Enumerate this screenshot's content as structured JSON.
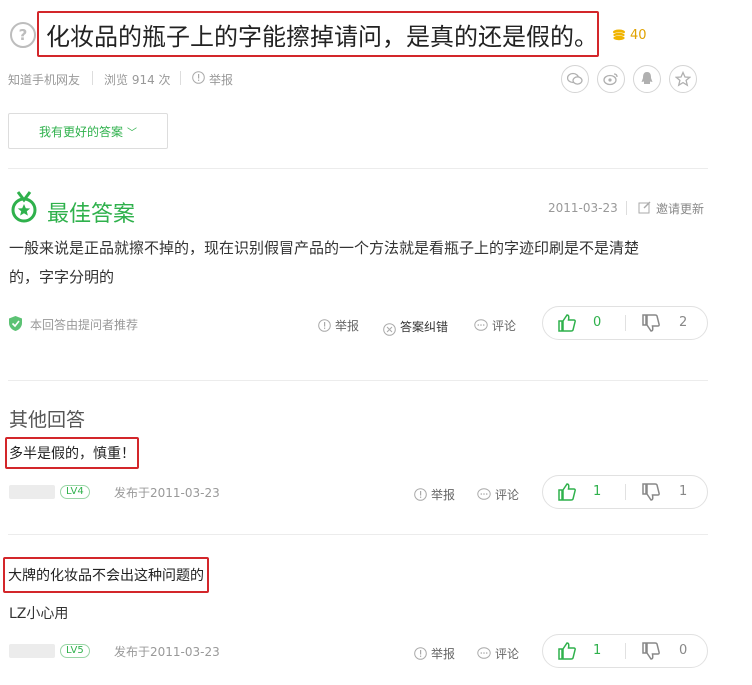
{
  "question": {
    "title": "化妆品的瓶子上的字能擦掉请问，是真的还是假的。",
    "reward": "40",
    "source": "知道手机网友",
    "views": "浏览 914 次",
    "report": "举报"
  },
  "better_answer_button": "我有更好的答案",
  "best_answer": {
    "heading": "最佳答案",
    "date": "2011-03-23",
    "invite": "邀请更新",
    "text_line1": "一般来说是正品就擦不掉的，现在识别假冒产品的一个方法就是看瓶子上的字迹印刷是不是清楚",
    "text_line2": "的，字字分明的",
    "recommended": "本回答由提问者推荐",
    "report": "举报",
    "correct": "答案纠错",
    "comment": "评论",
    "up": "0",
    "down": "2"
  },
  "other_answers": {
    "heading": "其他回答",
    "items": [
      {
        "text": "多半是假的，慎重！",
        "level": "LV4",
        "posted": "发布于2011-03-23",
        "report": "举报",
        "comment": "评论",
        "up": "1",
        "down": "1"
      },
      {
        "text": "大牌的化妆品不会出这种问题的",
        "text2": "LZ小心用",
        "level": "LV5",
        "posted": "发布于2011-03-23",
        "report": "举报",
        "comment": "评论",
        "up": "1",
        "down": "0"
      }
    ]
  },
  "colors": {
    "accent": "#2fb14c",
    "highlight": "#d3262a",
    "coin": "#e0a200"
  }
}
